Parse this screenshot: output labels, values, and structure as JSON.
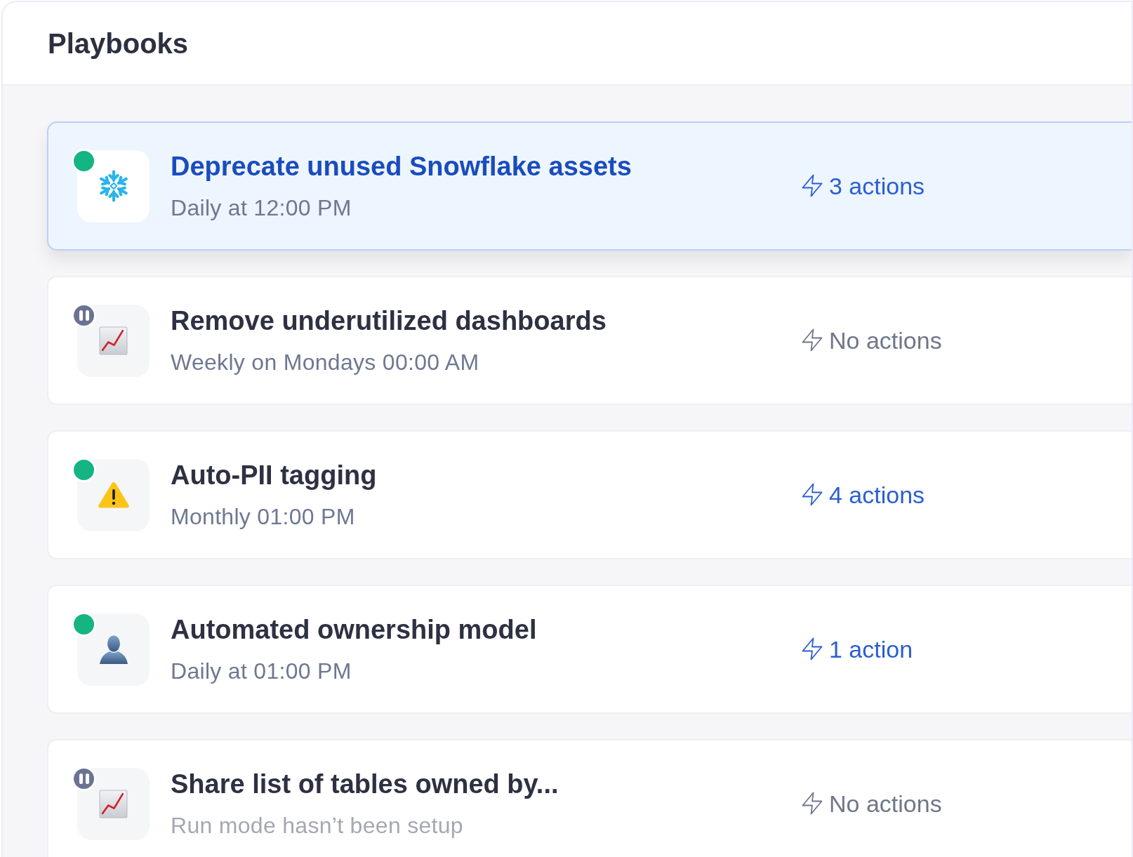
{
  "panel": {
    "title": "Playbooks"
  },
  "playbooks": [
    {
      "name": "Deprecate unused Snowflake assets",
      "schedule": "Daily at 12:00 PM",
      "scheduled": true,
      "paused": false,
      "kind": "snowflake",
      "selected": true,
      "actions": {
        "label": "3 actions",
        "empty": false
      }
    },
    {
      "name": "Remove underutilized dashboards",
      "schedule": "Weekly on Mondays 00:00 AM",
      "scheduled": true,
      "paused": true,
      "kind": "chart",
      "selected": false,
      "actions": {
        "label": "No actions",
        "empty": true
      }
    },
    {
      "name": "Auto-PII tagging",
      "schedule": "Monthly 01:00 PM",
      "scheduled": true,
      "paused": false,
      "kind": "warning",
      "selected": false,
      "actions": {
        "label": "4 actions",
        "empty": false
      }
    },
    {
      "name": "Automated ownership model",
      "schedule": "Daily at 01:00 PM",
      "scheduled": true,
      "paused": false,
      "kind": "person",
      "selected": false,
      "actions": {
        "label": "1 action",
        "empty": false
      }
    },
    {
      "name": "Share list of tables owned by...",
      "schedule": "Run mode hasn’t been setup",
      "scheduled": false,
      "paused": true,
      "kind": "chart",
      "selected": false,
      "actions": {
        "label": "No actions",
        "empty": true
      }
    }
  ]
}
